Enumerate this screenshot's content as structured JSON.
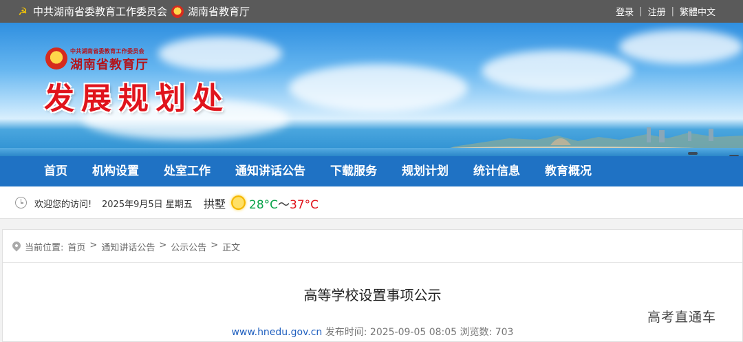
{
  "topbar": {
    "org_party": "中共湖南省委教育工作委员会",
    "org_gov": "湖南省教育厅",
    "login": "登录",
    "register": "注册",
    "traditional": "繁體中文"
  },
  "banner": {
    "org_small": "中共湖南省委教育工作委员会",
    "org_dept": "湖南省教育厅",
    "title": "发展规划处"
  },
  "nav": [
    {
      "label": "首页"
    },
    {
      "label": "机构设置"
    },
    {
      "label": "处室工作"
    },
    {
      "label": "通知讲话公告"
    },
    {
      "label": "下载服务"
    },
    {
      "label": "规划计划"
    },
    {
      "label": "统计信息"
    },
    {
      "label": "教育概况"
    }
  ],
  "info": {
    "welcome": "欢迎您的访问!",
    "date": "2025年9月5日 星期五",
    "city": "拱墅",
    "temp_low": "28°C",
    "tilde": "～",
    "temp_high": "37°C",
    "weather_icon": "sun-icon"
  },
  "breadcrumb": {
    "prefix": "当前位置:",
    "items": [
      "首页",
      "通知讲话公告",
      "公示公告",
      "正文"
    ],
    "separator": ">"
  },
  "article": {
    "title": "高等学校设置事项公示",
    "source": "www.hnedu.gov.cn",
    "published": "发布时间: 2025-09-05 08:05",
    "views": "浏览数: 703"
  },
  "watermark": "高考直通车",
  "colors": {
    "nav_bg": "#1f72c4",
    "topbar_bg": "#5a5a5a",
    "title_red": "#e0141c",
    "temp_low": "#0aa34a",
    "temp_high": "#e0141c"
  }
}
